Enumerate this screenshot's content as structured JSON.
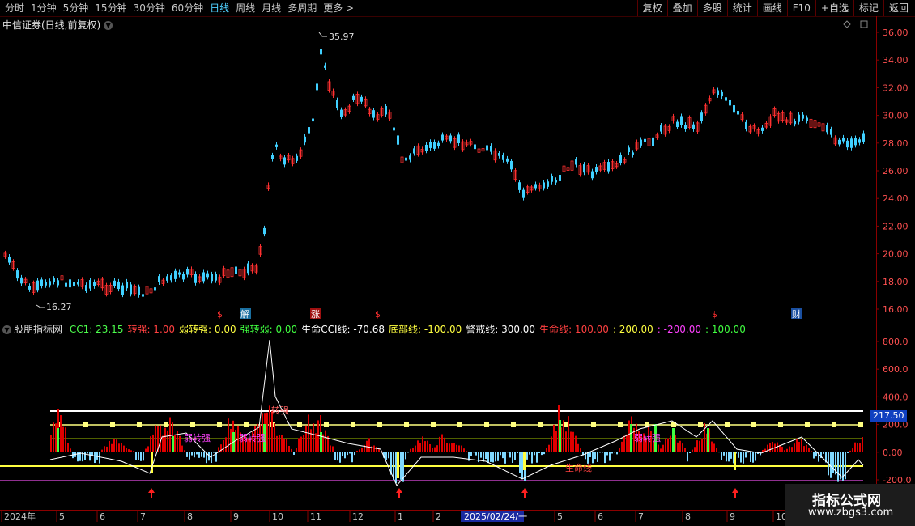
{
  "toolbar": {
    "periods": [
      "分时",
      "1分钟",
      "5分钟",
      "15分钟",
      "30分钟",
      "60分钟",
      "日线",
      "周线",
      "月线",
      "多周期",
      "更多 >"
    ],
    "active_period": "日线",
    "buttons": [
      "复权",
      "叠加",
      "多股",
      "统计",
      "画线",
      "F10",
      "+自选",
      "标记",
      "返回"
    ]
  },
  "main_chart": {
    "title": "中信证券(日线,前复权)",
    "high_label": "35.97",
    "low_label": "16.27",
    "y_ticks": [
      "36.00",
      "34.00",
      "32.00",
      "30.00",
      "28.00",
      "26.00",
      "24.00",
      "22.00",
      "20.00",
      "18.00",
      "16.00"
    ],
    "markers": [
      "$",
      "解",
      "涨",
      "$",
      "$",
      "财"
    ]
  },
  "indicator": {
    "name": "股朋指标网",
    "items": [
      {
        "text": "CC1: 23.15",
        "color": "#4cff4c"
      },
      {
        "text": "转强: 1.00",
        "color": "#ff4040"
      },
      {
        "text": "弱转强: 0.00",
        "color": "#ffff40"
      },
      {
        "text": "强转弱: 0.00",
        "color": "#40ff40"
      },
      {
        "text": "生命CCI线: -70.68",
        "color": "#ffffff"
      },
      {
        "text": "底部线: -100.00",
        "color": "#ffff40"
      },
      {
        "text": "警戒线: 300.00",
        "color": "#ffffff"
      },
      {
        "text": "生命线: 100.00",
        "color": "#ff4040"
      },
      {
        "text": ": 200.00",
        "color": "#ffff40"
      },
      {
        "text": ": -200.00",
        "color": "#ff40ff"
      },
      {
        "text": ": 100.00",
        "color": "#40ff40"
      }
    ],
    "y_ticks": [
      "800.0",
      "600.0",
      "400.0",
      "200.0",
      "0.00",
      "-200.0"
    ],
    "current_value": "217.50",
    "text_labels": {
      "zhuanqiang": "转强",
      "ruojiang": "弱转强",
      "shengmingxian": "生命线"
    }
  },
  "time_axis": [
    "2024年",
    "5",
    "6",
    "7",
    "8",
    "9",
    "10",
    "11",
    "12",
    "1",
    "2",
    "2025/02/24/一",
    "5",
    "6",
    "7",
    "8",
    "9",
    "10"
  ],
  "watermark": {
    "title": "指标公式网",
    "url": "www.zbgs3.com"
  }
}
